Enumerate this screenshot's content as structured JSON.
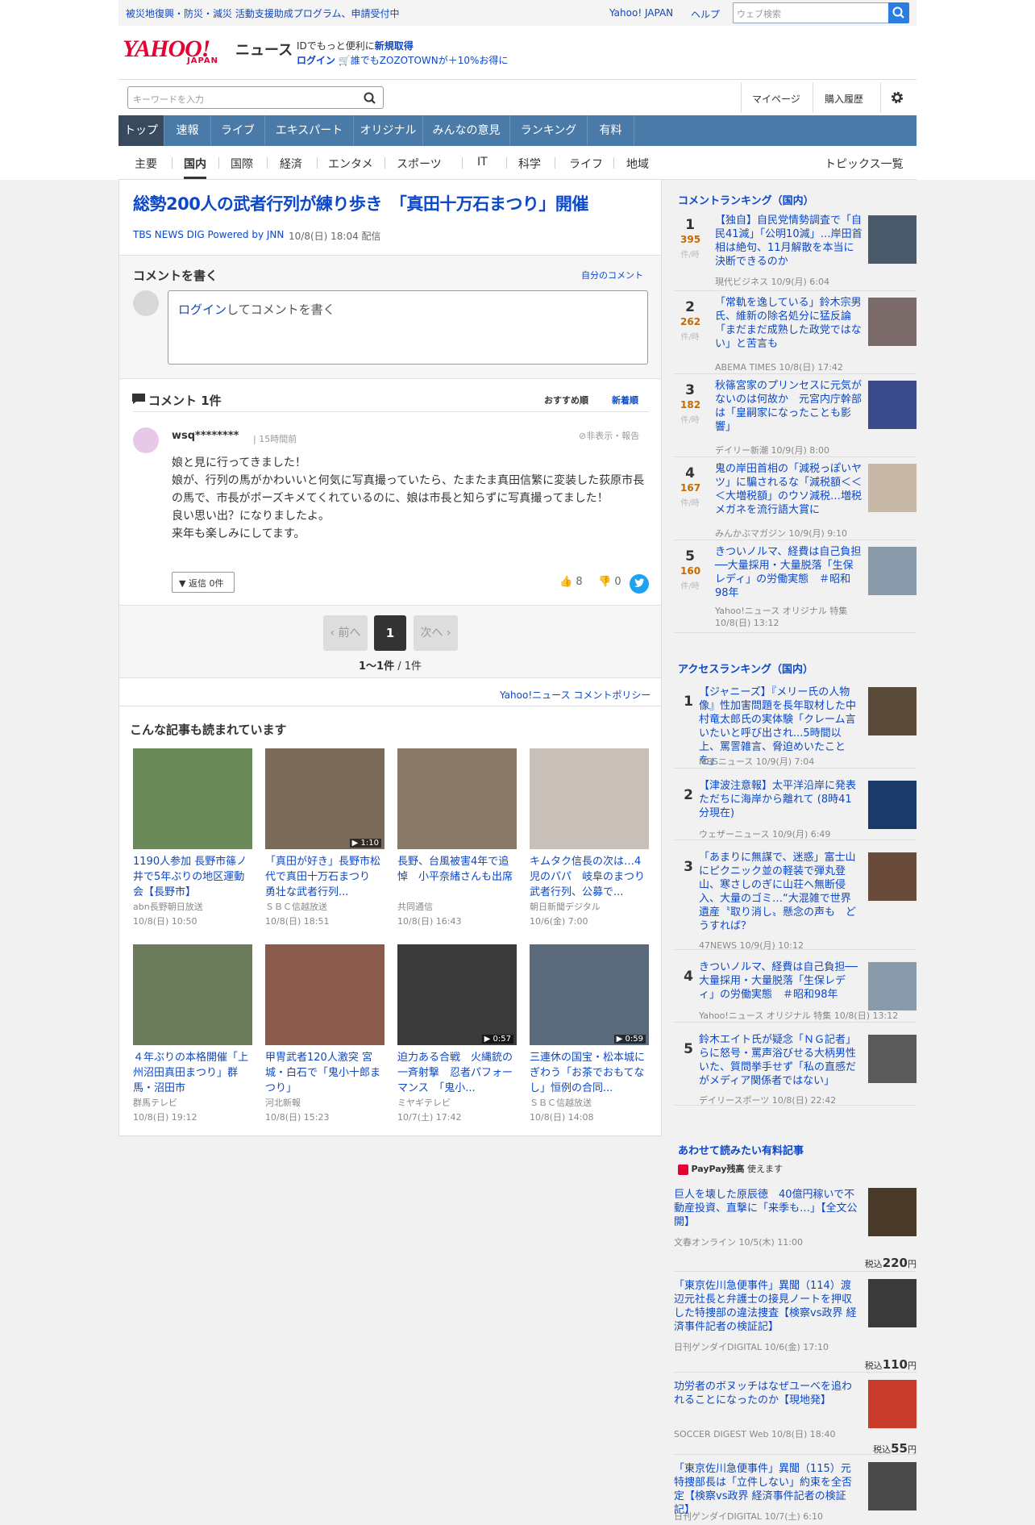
{
  "topbar": {
    "notice": "被災地復興・防災・減災 活動支援助成プログラム、申請受付中",
    "yahoo_japan": "Yahoo! JAPAN",
    "help": "ヘルプ",
    "web_search_placeholder": "ウェブ検索"
  },
  "brand": {
    "logo_text": "YAHOO!",
    "logo_sub": "JAPAN",
    "news": "ニュース"
  },
  "account": {
    "id_prefix": "IDでもっと便利に",
    "signup": "新規取得",
    "login": "ログイン",
    "zozo": "誰でもZOZOTOWNが＋10%お得に"
  },
  "search": {
    "placeholder": "キーワードを入力"
  },
  "mymenu": {
    "mypage": "マイページ",
    "history": "購入履歴"
  },
  "global_nav": [
    "トップ",
    "速報",
    "ライブ",
    "エキスパート",
    "オリジナル",
    "みんなの意見",
    "ランキング",
    "有料"
  ],
  "sub_nav": [
    "主要",
    "国内",
    "国際",
    "経済",
    "エンタメ",
    "スポーツ",
    "IT",
    "科学",
    "ライフ",
    "地域"
  ],
  "topics_all": "トピックス一覧",
  "article": {
    "title": "総勢200人の武者行列が練り歩き　「真田十万石まつり」開催",
    "source": "TBS NEWS DIG Powered by JNN",
    "date": "10/8(日) 18:04 配信"
  },
  "comment_write": {
    "heading": "コメントを書く",
    "my_comments": "自分のコメント",
    "login_link": "ログイン",
    "prompt": "してコメントを書く"
  },
  "comments": {
    "heading": "コメント 1件",
    "sort_recommended": "おすすめ順",
    "sort_new": "新着順",
    "items": [
      {
        "user": "wsq********",
        "time": "15時間前",
        "report": "非表示・報告",
        "lines": [
          "娘と見に行ってきました！",
          "娘が、行列の馬がかわいいと何気に写真撮っていたら、たまたま真田信繁に変装した荻原市長の馬で、市長がポーズキメてくれているのに、娘は市長と知らずに写真撮ってました！",
          "良い思い出？になりましたよ。",
          "来年も楽しみにしてます。"
        ],
        "reply": "返信 0件",
        "likes": "8",
        "dislikes": "0"
      }
    ]
  },
  "pager": {
    "prev": "前へ",
    "current": "1",
    "next": "次へ",
    "count": "1〜1件",
    "total": "/ 1件"
  },
  "policy": "Yahoo!ニュース コメントポリシー",
  "also_read": {
    "heading": "こんな記事も読まれています",
    "cards": [
      {
        "title": "1190人参加 長野市篠ノ井で5年ぶりの地区運動会【長野市】",
        "source": "abn長野朝日放送",
        "date": "10/8(日) 10:50",
        "duration": "",
        "color": "#6a8a5a"
      },
      {
        "title": "「真田が好き」長野市松代で真田十万石まつり　勇壮な武者行列...",
        "source": "ＳＢＣ信越放送",
        "date": "10/8(日) 18:51",
        "duration": "1:10",
        "color": "#7a6a5a"
      },
      {
        "title": "長野、台風被害4年で追悼　小平奈緒さんも出席",
        "source": "共同通信",
        "date": "10/8(日) 16:43",
        "duration": "",
        "color": "#8a7a6a"
      },
      {
        "title": "キムタク信長の次は…4児のパパ　岐阜のまつり武者行列、公募で...",
        "source": "朝日新聞デジタル",
        "date": "10/6(金) 7:00",
        "duration": "",
        "color": "#c8c0b8"
      },
      {
        "title": "４年ぶりの本格開催「上州沼田真田まつり」群馬・沼田市",
        "source": "群馬テレビ",
        "date": "10/8(日) 19:12",
        "duration": "",
        "color": "#6a7a5a"
      },
      {
        "title": "甲冑武者120人激突 宮城・白石で「鬼小十郎まつり」",
        "source": "河北新報",
        "date": "10/8(日) 15:23",
        "duration": "",
        "color": "#8a5a4a"
      },
      {
        "title": "迫力ある合戦　火縄銃の一斉射撃　忍者パフォーマンス　「鬼小...",
        "source": "ミヤギテレビ",
        "date": "10/7(土) 17:42",
        "duration": "0:57",
        "color": "#3a3a3a"
      },
      {
        "title": "三連休の国宝・松本城にぎわう「お茶でおもてなし」恒例の合同...",
        "source": "ＳＢＣ信越放送",
        "date": "10/8(日) 14:08",
        "duration": "0:59",
        "color": "#5a6a7a"
      }
    ]
  },
  "comment_ranking": {
    "heading": "コメントランキング（国内）",
    "unit": "件/時",
    "items": [
      {
        "rank": "1",
        "count": "395",
        "title": "【独自】自民党情勢調査で「自民41減」「公明10減」…岸田首相は絶句、11月解散を本当に決断できるのか",
        "source": "現代ビジネス 10/9(月) 6:04",
        "color": "#4a5a6a"
      },
      {
        "rank": "2",
        "count": "262",
        "title": "「常軌を逸している」鈴木宗男氏、維新の除名処分に猛反論「まだまだ成熟した政党ではない」と苦言も",
        "source": "ABEMA TIMES 10/8(日) 17:42",
        "color": "#7a6a6a"
      },
      {
        "rank": "3",
        "count": "182",
        "title": "秋篠宮家のプリンセスに元気がないのは何故か　元宮内庁幹部は「皇嗣家になったことも影響」",
        "source": "デイリー新潮 10/9(月) 8:00",
        "color": "#3a4a8a"
      },
      {
        "rank": "4",
        "count": "167",
        "title": "鬼の岸田首相の「減税っぽいヤツ」に騙されるな「減税額＜＜＜大増税額」のウソ減税…増税メガネを流行語大賞に",
        "source": "みんかぶマガジン 10/9(月) 9:10",
        "color": "#c8b8a8"
      },
      {
        "rank": "5",
        "count": "160",
        "title": "きついノルマ、経費は自己負担──大量採用・大量脱落「生保レディ」の労働実態　＃昭和98年",
        "source": "Yahoo!ニュース オリジナル 特集 10/8(日) 13:12",
        "color": "#8a9aaa"
      }
    ]
  },
  "access_ranking": {
    "heading": "アクセスランキング（国内）",
    "items": [
      {
        "rank": "1",
        "title": "【ジャニーズ】『メリー氏の人物像』性加害問題を長年取材した中村竜太郎氏の実体験「クレーム言いたいと呼び出され...5時間以上、罵詈雑言、脅迫めいたことを」",
        "source": "MBSニュース 10/9(月) 7:04",
        "color": "#5a4a3a"
      },
      {
        "rank": "2",
        "title": "【津波注意報】太平洋沿岸に発表 ただちに海岸から離れて (8時41分現在)",
        "source": "ウェザーニュース 10/9(月) 6:49",
        "color": "#1a3a6a"
      },
      {
        "rank": "3",
        "title": "「あまりに無謀で、迷惑」富士山にピクニック並の軽装で弾丸登山、寒さしのぎに山荘へ無断侵入、大量のゴミ…“大混雑で世界遺産〝取り消し〟懸念の声も　どうすれば？",
        "source": "47NEWS 10/9(月) 10:12",
        "color": "#6a4a3a"
      },
      {
        "rank": "4",
        "title": "きついノルマ、経費は自己負担──大量採用・大量脱落「生保レディ」の労働実態　＃昭和98年",
        "source": "Yahoo!ニュース オリジナル 特集 10/8(日) 13:12",
        "color": "#8a9aaa"
      },
      {
        "rank": "5",
        "title": "鈴木エイト氏が疑念「ＮＧ記者」らに怒号・罵声浴びせる大柄男性いた、質問挙手せず「私の直感だがメディア関係者ではない」",
        "source": "デイリースポーツ 10/8(日) 22:42",
        "color": "#5a5a5a"
      }
    ]
  },
  "paid": {
    "heading": "あわせて読みたい有料記事",
    "paypay": "PayPay残高",
    "paypay_suffix": " 使えます",
    "items": [
      {
        "title": "巨人を壊した原辰徳　40億円稼いで不動産投資、直撃に「来季も…」【全文公開】",
        "source": "文春オンライン 10/5(木) 11:00",
        "price_prefix": "税込",
        "price": "220",
        "price_unit": "円",
        "color": "#4a3a2a"
      },
      {
        "title": "「東京佐川急便事件」異聞（114）渡辺元社長と弁護士の接見ノートを押収した特捜部の違法捜査【検察vs政界 経済事件記者の検証記】",
        "source": "日刊ゲンダイDIGITAL 10/6(金) 17:10",
        "price_prefix": "税込",
        "price": "110",
        "price_unit": "円",
        "color": "#3a3a3a"
      },
      {
        "title": "功労者のボヌッチはなぜユーベを追われることになったのか【現地発】",
        "source": "SOCCER DIGEST Web 10/8(日) 18:40",
        "price_prefix": "税込",
        "price": "55",
        "price_unit": "円",
        "color": "#c83a2a"
      },
      {
        "title": "「東京佐川急便事件」異聞（115）元特捜部長は「立件しない」約束を全否定【検察vs政界 経済事件記者の検証記】",
        "source": "日刊ゲンダイDIGITAL 10/7(土) 6:10",
        "price_prefix": "",
        "price": "",
        "price_unit": "",
        "color": "#4a4a4a"
      }
    ]
  }
}
